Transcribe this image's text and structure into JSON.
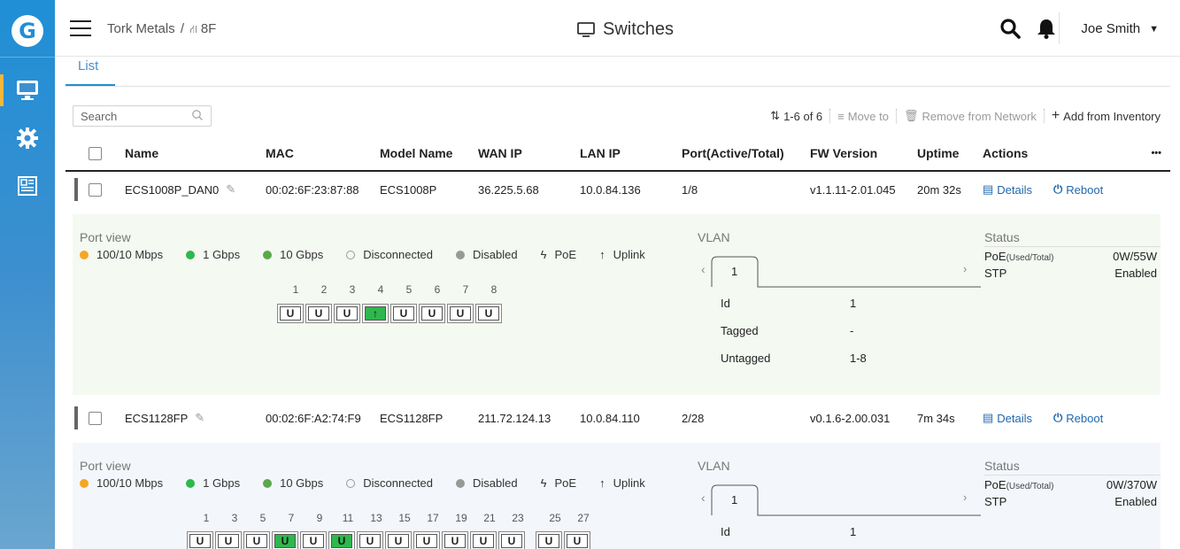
{
  "app": {
    "logo_letter": "G"
  },
  "header": {
    "breadcrumb_org": "Tork Metals",
    "breadcrumb_sep": "/",
    "breadcrumb_network": "8F",
    "title": "Switches",
    "user": "Joe Smith"
  },
  "tabs": [
    {
      "label": "List"
    }
  ],
  "toolbar": {
    "search_placeholder": "Search",
    "page_count": "1-6 of 6",
    "move_to": "Move to",
    "remove": "Remove from Network",
    "add": "Add from Inventory"
  },
  "columns": {
    "name": "Name",
    "mac": "MAC",
    "model": "Model Name",
    "wan": "WAN IP",
    "lan": "LAN IP",
    "port": "Port(Active/Total)",
    "fw": "FW Version",
    "uptime": "Uptime",
    "actions": "Actions",
    "more": "•••"
  },
  "rows": [
    {
      "name": "ECS1008P_DAN0",
      "mac": "00:02:6F:23:87:88",
      "model": "ECS1008P",
      "wan": "36.225.5.68",
      "lan": "10.0.84.136",
      "port": "1/8",
      "fw": "v1.1.11-2.01.045",
      "uptime": "20m 32s",
      "details": "Details",
      "reboot": "Reboot"
    },
    {
      "name": "ECS1128FP",
      "mac": "00:02:6F:A2:74:F9",
      "model": "ECS1128FP",
      "wan": "211.72.124.13",
      "lan": "10.0.84.110",
      "port": "2/28",
      "fw": "v0.1.6-2.00.031",
      "uptime": "7m 34s",
      "details": "Details",
      "reboot": "Reboot"
    }
  ],
  "panel_labels": {
    "port_view": "Port view",
    "vlan": "VLAN",
    "status": "Status",
    "legend": [
      "100/10 Mbps",
      "1 Gbps",
      "10 Gbps",
      "Disconnected",
      "Disabled",
      "PoE",
      "Uplink"
    ],
    "legend_colors": [
      "#f6a623",
      "#2eb84d",
      "#5aa84a",
      "#999999",
      "#999999"
    ],
    "id": "Id",
    "tagged": "Tagged",
    "untagged": "Untagged",
    "poe": "PoE",
    "poe_sub": "(Used/Total)",
    "stp": "STP"
  },
  "panels": [
    {
      "port_numbers": [
        "1",
        "2",
        "3",
        "4",
        "5",
        "6",
        "7",
        "8"
      ],
      "ports": [
        "U",
        "U",
        "U",
        "↑",
        "U",
        "U",
        "U",
        "U"
      ],
      "port_up": [
        false,
        false,
        false,
        true,
        false,
        false,
        false,
        false
      ],
      "vlan_tab": "1",
      "vlan_id": "1",
      "vlan_tagged": "-",
      "vlan_untagged": "1-8",
      "poe_value": "0W/55W",
      "stp_value": "Enabled"
    },
    {
      "port_numbers": [
        "1",
        "3",
        "5",
        "7",
        "9",
        "11",
        "13",
        "15",
        "17",
        "19",
        "21",
        "23",
        "25",
        "27"
      ],
      "ports": [
        "U",
        "U",
        "U",
        "U",
        "U",
        "U",
        "U",
        "U",
        "U",
        "U",
        "U",
        "U",
        "U",
        "U"
      ],
      "port_up": [
        false,
        false,
        false,
        true,
        false,
        true,
        false,
        false,
        false,
        false,
        false,
        false,
        false,
        false
      ],
      "vlan_tab": "1",
      "vlan_id": "1",
      "poe_value": "0W/370W",
      "stp_value": "Enabled"
    }
  ]
}
